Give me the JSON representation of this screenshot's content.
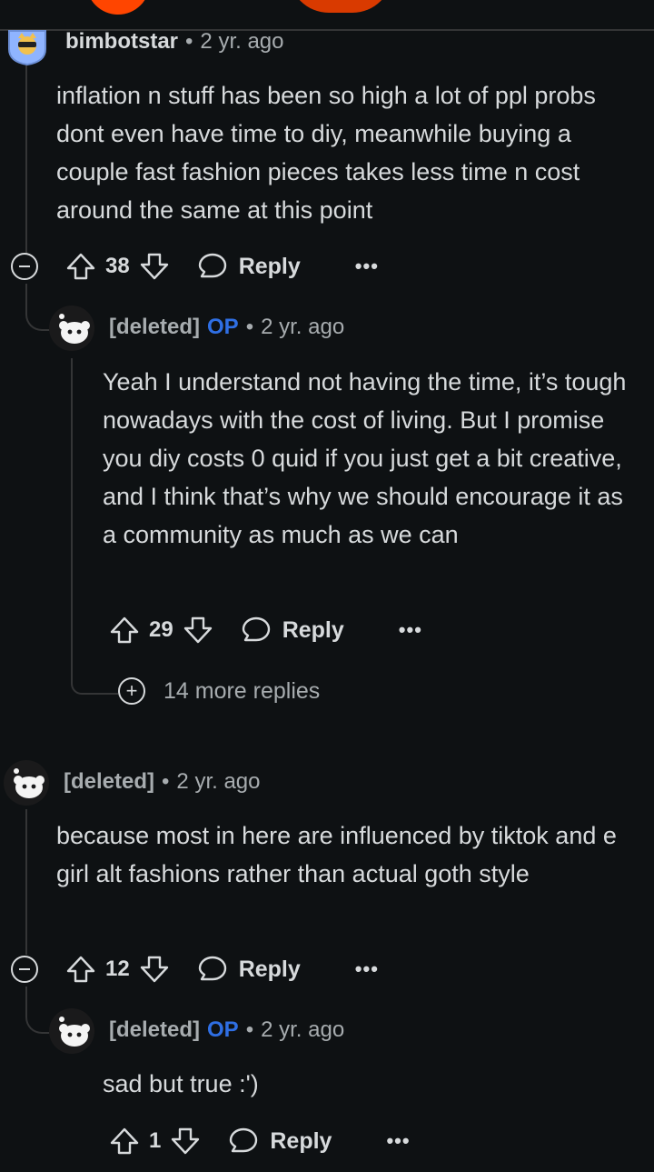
{
  "comments": [
    {
      "author": "bimbotstar",
      "time": "2 yr. ago",
      "body": "inflation n stuff has been so high a lot of ppl probs dont even have time to diy, meanwhile buying a couple fast fashion pieces takes less time n cost around the same at this point",
      "votes": "38",
      "reply_label": "Reply",
      "more_label": "•••",
      "replies": [
        {
          "author": "[deleted]",
          "op_badge": "OP",
          "time": "2 yr. ago",
          "body": "Yeah I understand not having the time, it’s tough nowadays with the cost of living. But I promise you diy costs 0 quid if you just get a bit creative, and I think that’s why we should encourage it as a community as much as we can",
          "votes": "29",
          "reply_label": "Reply",
          "more_label": "•••"
        }
      ],
      "more_replies": "14 more replies"
    },
    {
      "author": "[deleted]",
      "time": "2 yr. ago",
      "body": "because most in here are influenced by tiktok and e girl alt fashions rather than actual goth style",
      "votes": "12",
      "reply_label": "Reply",
      "more_label": "•••",
      "replies": [
        {
          "author": "[deleted]",
          "op_badge": "OP",
          "time": "2 yr. ago",
          "body": "sad but true :')",
          "votes": "1",
          "reply_label": "Reply",
          "more_label": "•••"
        }
      ]
    }
  ],
  "header_dot": "•",
  "colors": {
    "background": "#0e1113",
    "op": "#2f6fe4",
    "accent": "#ff4500",
    "thread_line": "#343536"
  },
  "icons": [
    "upvote-icon",
    "downvote-icon",
    "comment-bubble-icon",
    "collapse-icon",
    "expand-icon",
    "avatar-icon",
    "snoo-avatar-icon"
  ]
}
